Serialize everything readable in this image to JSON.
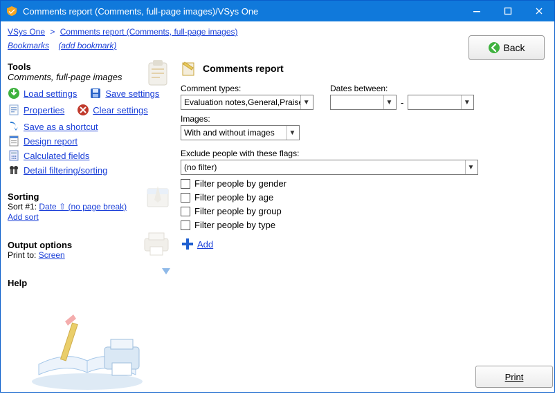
{
  "window": {
    "title": "Comments report (Comments, full-page images)/VSys One"
  },
  "breadcrumb": {
    "root": "VSys One",
    "current": "Comments report (Comments, full-page images)"
  },
  "bookmarks": {
    "label": "Bookmarks",
    "add": "(add bookmark)"
  },
  "back_label": "Back",
  "tools": {
    "heading": "Tools",
    "subtitle": "Comments, full-page images",
    "load": "Load settings",
    "save": "Save settings",
    "properties": "Properties",
    "clear": "Clear settings",
    "shortcut": "Save as a shortcut",
    "design": "Design report",
    "calc": "Calculated fields",
    "detail": "Detail filtering/sorting"
  },
  "sorting": {
    "heading": "Sorting",
    "line_prefix": "Sort #1:",
    "link": "Date ⇧ (no page break)",
    "add": "Add sort"
  },
  "output": {
    "heading": "Output options",
    "prefix": "Print to:",
    "target": "Screen"
  },
  "help": {
    "heading": "Help"
  },
  "main": {
    "title": "Comments report",
    "comment_types_label": "Comment types:",
    "comment_types_value": "Evaluation notes,General,Praise",
    "dates_label": "Dates between:",
    "date_from": "",
    "date_to": "",
    "images_label": "Images:",
    "images_value": "With and without images",
    "exclude_label": "Exclude people with these flags:",
    "exclude_value": "(no filter)",
    "checks": {
      "gender": "Filter people by gender",
      "age": "Filter people by age",
      "group": "Filter people by group",
      "type": "Filter people by type"
    },
    "add": "Add"
  },
  "print_label": "Print"
}
